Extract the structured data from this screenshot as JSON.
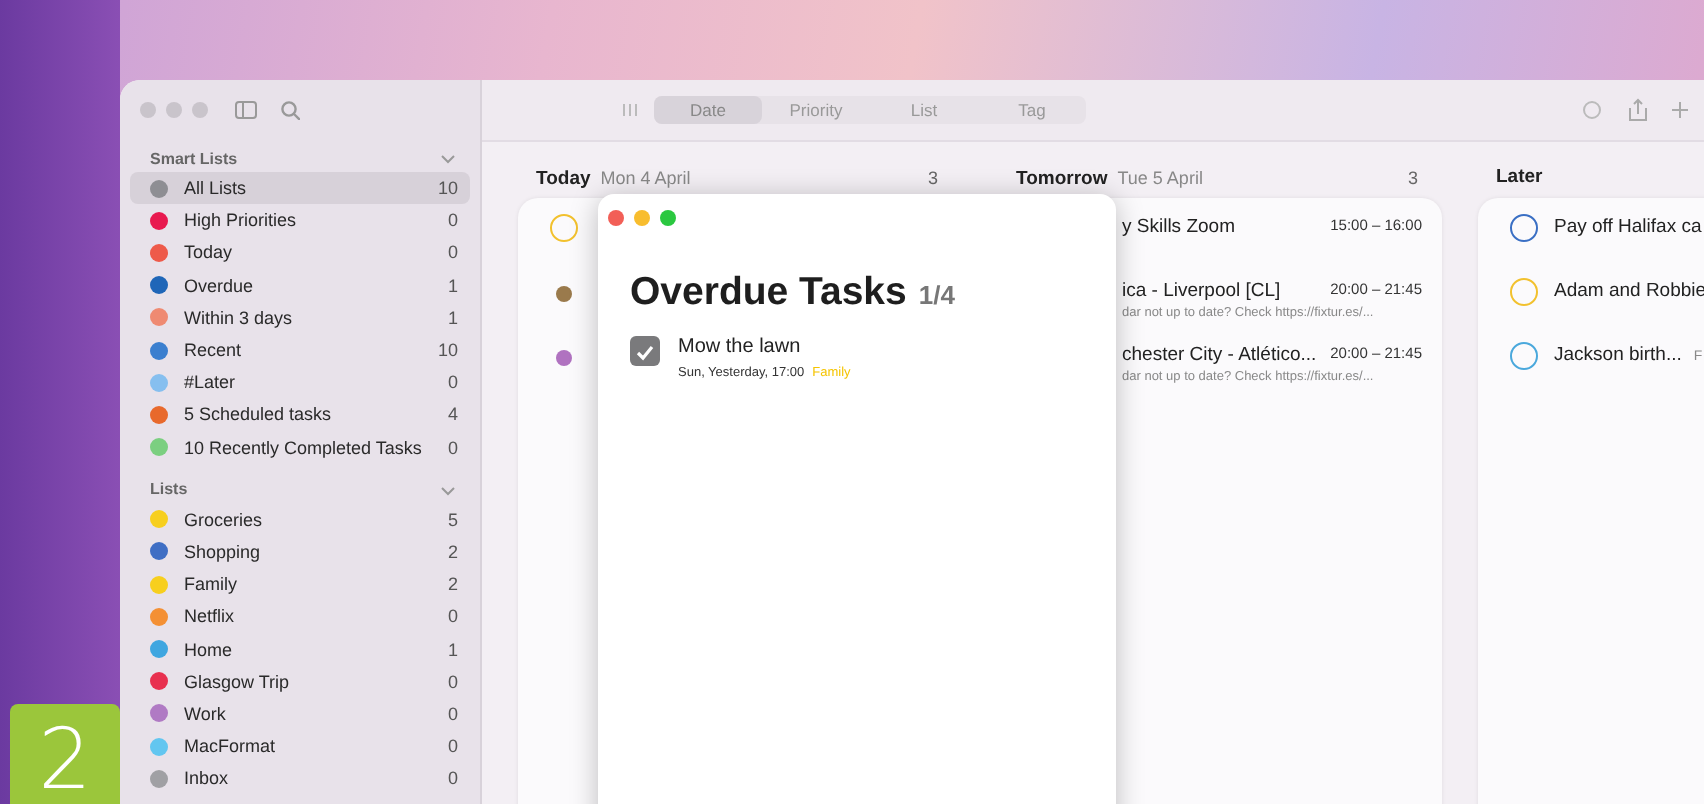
{
  "toolbar": {
    "view_tabs": [
      {
        "label": "Date",
        "selected": true
      },
      {
        "label": "Priority",
        "selected": false
      },
      {
        "label": "List",
        "selected": false
      },
      {
        "label": "Tag",
        "selected": false
      }
    ]
  },
  "smart_lists": {
    "title": "Smart Lists",
    "items": [
      {
        "label": "All Lists",
        "count": "10",
        "color": "#8e8e93",
        "selected": true
      },
      {
        "label": "High Priorities",
        "count": "0",
        "color": "#e8194f",
        "selected": false
      },
      {
        "label": "Today",
        "count": "0",
        "color": "#ee5a4a",
        "selected": false
      },
      {
        "label": "Overdue",
        "count": "1",
        "color": "#1f66b8",
        "selected": false
      },
      {
        "label": "Within 3 days",
        "count": "1",
        "color": "#ef8a72",
        "selected": false
      },
      {
        "label": "Recent",
        "count": "10",
        "color": "#3b7fcf",
        "selected": false
      },
      {
        "label": "#Later",
        "count": "0",
        "color": "#86bfef",
        "selected": false
      },
      {
        "label": "5 Scheduled tasks",
        "count": "4",
        "color": "#e8692c",
        "selected": false
      },
      {
        "label": "10 Recently Completed Tasks",
        "count": "0",
        "color": "#7bcf80",
        "selected": false
      }
    ]
  },
  "lists": {
    "title": "Lists",
    "items": [
      {
        "label": "Groceries",
        "count": "5",
        "color": "#f7cf1e",
        "selected": false
      },
      {
        "label": "Shopping",
        "count": "2",
        "color": "#3f6ec4",
        "selected": false
      },
      {
        "label": "Family",
        "count": "2",
        "color": "#f7cf1e",
        "selected": false
      },
      {
        "label": "Netflix",
        "count": "0",
        "color": "#f49034",
        "selected": false
      },
      {
        "label": "Home",
        "count": "1",
        "color": "#3fa6e0",
        "selected": false
      },
      {
        "label": "Glasgow Trip",
        "count": "0",
        "color": "#e8304f",
        "selected": false
      },
      {
        "label": "Work",
        "count": "0",
        "color": "#b07ac4",
        "selected": false
      },
      {
        "label": "MacFormat",
        "count": "0",
        "color": "#62c6f0",
        "selected": false
      },
      {
        "label": "Inbox",
        "count": "0",
        "color": "#a0a0a4",
        "selected": false
      }
    ]
  },
  "columns": [
    {
      "title": "Today",
      "date": "Mon 4 April",
      "count": "3",
      "tasks": [
        {
          "kind": "ring",
          "color": "#f2c12e"
        },
        {
          "kind": "dot",
          "color": "#9a7a4c"
        },
        {
          "kind": "dot",
          "color": "#b072c0"
        }
      ]
    },
    {
      "title": "Tomorrow",
      "date": "Tue 5 April",
      "count": "3",
      "tasks": [
        {
          "kind": "event",
          "title": "y Skills Zoom",
          "time": "15:00 – 16:00"
        },
        {
          "kind": "event",
          "title": "ica - Liverpool [CL]",
          "time": "20:00 – 21:45",
          "note": "dar not up to date? Check https://fixtur.es/..."
        },
        {
          "kind": "event",
          "title": "chester City - Atlético...",
          "time": "20:00 – 21:45",
          "note": "dar not up to date? Check https://fixtur.es/..."
        }
      ]
    },
    {
      "title": "Later",
      "tasks": [
        {
          "kind": "ring",
          "color": "#3a6fc4",
          "title": "Pay off Halifax ca"
        },
        {
          "kind": "ring",
          "color": "#f2c12e",
          "title": "Adam and Robbie"
        },
        {
          "kind": "ring",
          "color": "#4aa8dc",
          "title": "Jackson birth...",
          "extra": "F"
        }
      ]
    }
  ],
  "popup": {
    "title": "Overdue Tasks",
    "progress": "1/4",
    "tasks": [
      {
        "title": "Mow the lawn",
        "checked": true,
        "meta": "Sun, Yesterday, 17:00",
        "tag": {
          "label": "Family",
          "color": "#f5c400"
        }
      }
    ]
  },
  "step_badge": "2"
}
